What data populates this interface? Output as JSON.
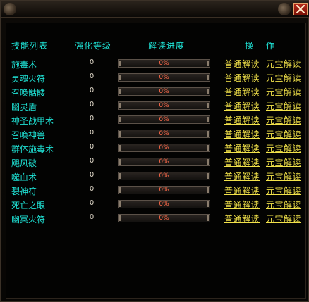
{
  "window": {
    "close_icon": "close-x-icon",
    "close_color": "#b82a1a"
  },
  "header": {
    "skill_list": "技能列表",
    "enhance_level": "强化等级",
    "decode_progress": "解读进度",
    "operations": "操 作"
  },
  "labels": {
    "normal_decode": "普通解读",
    "yuanbao_decode": "元宝解读"
  },
  "skills": [
    {
      "name": "施毒术",
      "level": "0",
      "progress_text": "0%",
      "progress": 0
    },
    {
      "name": "灵魂火符",
      "level": "0",
      "progress_text": "0%",
      "progress": 0
    },
    {
      "name": "召唤骷髅",
      "level": "0",
      "progress_text": "0%",
      "progress": 0
    },
    {
      "name": "幽灵盾",
      "level": "0",
      "progress_text": "0%",
      "progress": 0
    },
    {
      "name": "神圣战甲术",
      "level": "0",
      "progress_text": "0%",
      "progress": 0
    },
    {
      "name": "召唤神兽",
      "level": "0",
      "progress_text": "0%",
      "progress": 0
    },
    {
      "name": "群体施毒术",
      "level": "0",
      "progress_text": "0%",
      "progress": 0
    },
    {
      "name": "飓风破",
      "level": "0",
      "progress_text": "0%",
      "progress": 0
    },
    {
      "name": "噬血术",
      "level": "0",
      "progress_text": "0%",
      "progress": 0
    },
    {
      "name": "裂神符",
      "level": "0",
      "progress_text": "0%",
      "progress": 0
    },
    {
      "name": "死亡之眼",
      "level": "0",
      "progress_text": "0%",
      "progress": 0
    },
    {
      "name": "幽冥火符",
      "level": "0",
      "progress_text": "0%",
      "progress": 0
    }
  ],
  "colors": {
    "skill_text": "#1fe2d5",
    "link_text": "#f2e24a",
    "progress_text": "#ff6a4a"
  }
}
